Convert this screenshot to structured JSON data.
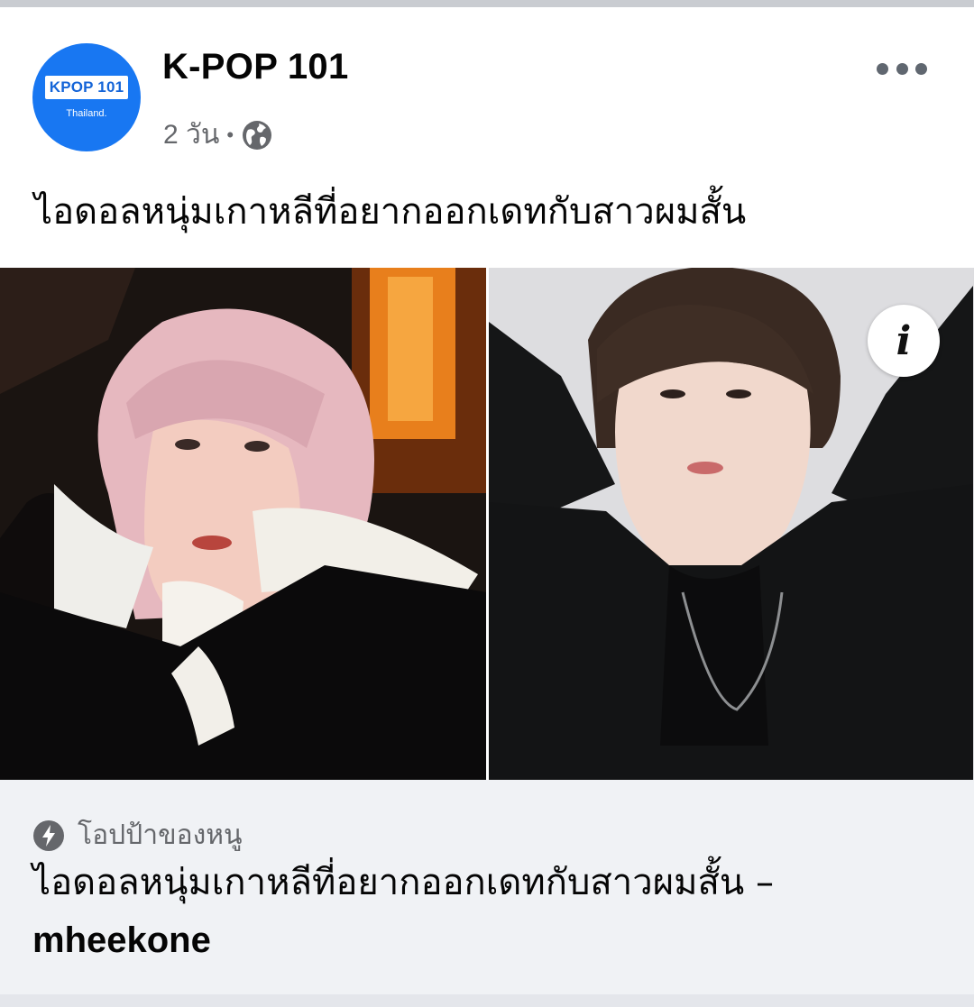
{
  "post": {
    "page_name": "K-POP 101",
    "avatar": {
      "badge_text": "KPOP 101",
      "subtext": "Thailand.",
      "color": "#1877f2"
    },
    "time": "2 วัน",
    "separator": "•",
    "privacy_icon": "globe-icon",
    "more_icon": "more-horizontal-icon",
    "caption": "ไอดอลหนุ่มเกาหลีที่อยากออกเดทกับสาวผมสั้น"
  },
  "media": {
    "info_icon": "info-icon",
    "info_glyph": "i"
  },
  "link_preview": {
    "source_icon": "bolt-icon",
    "source": "โอปป้าของหนู",
    "title": "ไอดอลหนุ่มเกาหลีที่อยากออกเดทกับสาวผมสั้น –",
    "domain": "mheekone"
  },
  "colors": {
    "accent": "#1877f2",
    "meta": "#65676b",
    "preview_bg": "#f0f2f5"
  }
}
